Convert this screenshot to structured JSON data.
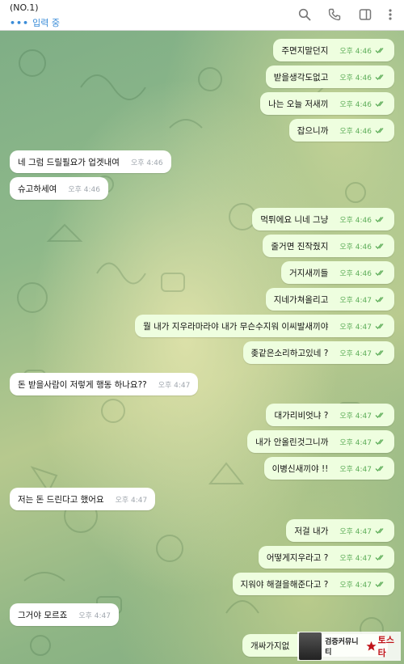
{
  "header": {
    "title": "(NO.1)",
    "typing_dots": "•••",
    "status": "입력 중"
  },
  "icons": {
    "search": "search-icon",
    "call": "phone-icon",
    "panel": "side-panel-icon",
    "more": "more-vertical-icon",
    "read": "double-check-icon"
  },
  "colors": {
    "outgoing_bubble": "#eefedf",
    "incoming_bubble": "#ffffff",
    "outgoing_time": "#5fae5a",
    "incoming_time": "#a0a7ae",
    "typing": "#3a8cd8"
  },
  "messages": [
    {
      "text": "주면지말던지",
      "time": "오후 4:46",
      "dir": "out"
    },
    {
      "text": "받을생각도없고",
      "time": "오후 4:46",
      "dir": "out"
    },
    {
      "text": "나는 오늘 저새끼",
      "time": "오후 4:46",
      "dir": "out"
    },
    {
      "text": "잡으니까",
      "time": "오후 4:46",
      "dir": "out"
    },
    {
      "text": "네 그럼 드릴필요가 업겟내여",
      "time": "오후 4:46",
      "dir": "in"
    },
    {
      "text": "슈고하세여",
      "time": "오후 4:46",
      "dir": "in"
    },
    {
      "text": "먹튀에요 니네 그냥",
      "time": "오후 4:46",
      "dir": "out"
    },
    {
      "text": "줄거면 진작줬지",
      "time": "오후 4:46",
      "dir": "out"
    },
    {
      "text": "거지새끼들",
      "time": "오후 4:46",
      "dir": "out"
    },
    {
      "text": "지네가쳐올리고",
      "time": "오후 4:47",
      "dir": "out"
    },
    {
      "text": "뭘 내가 지우라마라야 내가 무슨수지워 이씨발새끼야",
      "time": "오후 4:47",
      "dir": "out"
    },
    {
      "text": "좆같은소리하고있네 ?",
      "time": "오후 4:47",
      "dir": "out"
    },
    {
      "text": "돈 받을사람이 저렇게 행동 하나요??",
      "time": "오후 4:47",
      "dir": "in"
    },
    {
      "text": "대가리비엇냐 ?",
      "time": "오후 4:47",
      "dir": "out"
    },
    {
      "text": "내가 안올린것그니까",
      "time": "오후 4:47",
      "dir": "out"
    },
    {
      "text": "이병신새끼야 !!",
      "time": "오후 4:47",
      "dir": "out"
    },
    {
      "text": "저는 돈 드린다고 했어요",
      "time": "오후 4:47",
      "dir": "in"
    },
    {
      "text": "저걸 내가",
      "time": "오후 4:47",
      "dir": "out"
    },
    {
      "text": "어떻게지우라고 ?",
      "time": "오후 4:47",
      "dir": "out"
    },
    {
      "text": "지워야 해결을해준다고 ?",
      "time": "오후 4:47",
      "dir": "out"
    },
    {
      "text": "그거야 모르죠",
      "time": "오후 4:47",
      "dir": "in"
    },
    {
      "text": "개싸가지없",
      "time": "",
      "dir": "out"
    }
  ],
  "watermark": {
    "label": "검증커뮤니티",
    "brand": "토스타"
  }
}
